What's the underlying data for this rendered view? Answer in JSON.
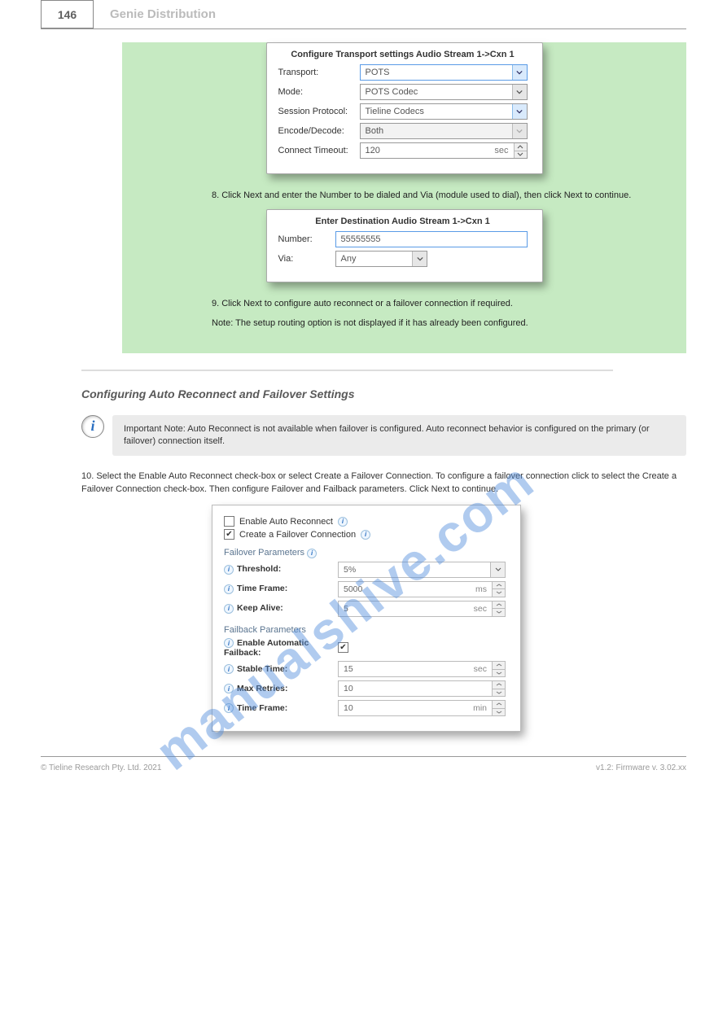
{
  "header": {
    "page_num": "146",
    "title": "Genie Distribution"
  },
  "dialog1": {
    "title": "Configure Transport settings Audio Stream 1->Cxn 1",
    "transport_lbl": "Transport:",
    "transport_val": "POTS",
    "mode_lbl": "Mode:",
    "mode_val": "POTS Codec",
    "session_lbl": "Session Protocol:",
    "session_val": "Tieline Codecs",
    "encdec_lbl": "Encode/Decode:",
    "encdec_val": "Both",
    "timeout_lbl": "Connect Timeout:",
    "timeout_val": "120",
    "timeout_unit": "sec"
  },
  "step8": "8. Click Next and enter the Number to be dialed and Via (module used to dial), then click Next to continue.",
  "dialog2": {
    "title": "Enter Destination Audio Stream 1->Cxn 1",
    "number_lbl": "Number:",
    "number_val": "55555555",
    "via_lbl": "Via:",
    "via_val": "Any"
  },
  "step9": "9. Click Next to configure auto reconnect or a failover connection if required.",
  "note9": "Note: The setup routing option is not displayed if it has already been configured.",
  "section": "Configuring Auto Reconnect and Failover Settings",
  "info_note": "Important Note: Auto Reconnect is not available when failover is configured. Auto reconnect behavior is configured on the primary (or failover) connection itself.",
  "steps_10": "10. Select the Enable Auto Reconnect check-box or select Create a Failover Connection. To configure a failover connection click to select the Create a Failover Connection check-box. Then configure Failover and Failback parameters. Click Next to continue.",
  "panel2": {
    "auto_lbl": "Enable Auto Reconnect",
    "fail_lbl": "Create a Failover Connection",
    "fail_params": "Failover Parameters",
    "threshold_lbl": "Threshold:",
    "threshold_val": "5%",
    "timeframe_lbl": "Time Frame:",
    "timeframe_val": "5000",
    "timeframe_unit": "ms",
    "keepalive_lbl": "Keep Alive:",
    "keepalive_val": "5",
    "keepalive_unit": "sec",
    "failback_params": "Failback Parameters",
    "enable_fb_lbl": "Enable Automatic Failback:",
    "stable_lbl": "Stable Time:",
    "stable_val": "15",
    "stable_unit": "sec",
    "maxretries_lbl": "Max Retries:",
    "maxretries_val": "10",
    "tf2_lbl": "Time Frame:",
    "tf2_val": "10",
    "tf2_unit": "min"
  },
  "footer": {
    "copyright": "© Tieline Research Pty. Ltd. 2021",
    "ver": "v1.2: Firmware v. 3.02.xx"
  },
  "watermark": "manualshive.com"
}
